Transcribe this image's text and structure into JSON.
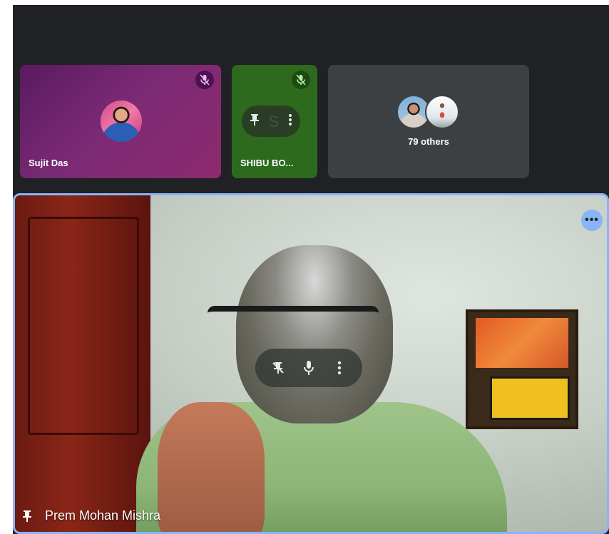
{
  "tiles": [
    {
      "name": "Sujit Das",
      "muted": true,
      "accent": "#7a2a74"
    },
    {
      "name": "SHIBU BO...",
      "initial": "S",
      "muted": true,
      "accent": "#2d6a1e"
    }
  ],
  "others": {
    "label": "79 others"
  },
  "main": {
    "name": "Prem Mohan Mishra",
    "pinned": true,
    "more_label": "•••",
    "border_color": "#8ab4f8"
  },
  "icons": {
    "mic_off": "mic-off-icon",
    "pin": "pin-icon",
    "unpin": "unpin-icon",
    "mic": "mic-icon",
    "more_vert": "more-vert-icon"
  }
}
